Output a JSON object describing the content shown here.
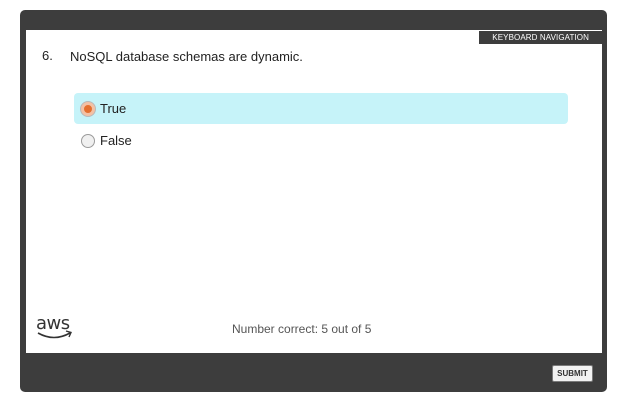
{
  "header": {
    "keyboard_navigation": "KEYBOARD NAVIGATION"
  },
  "question": {
    "number": "6.",
    "text": "NoSQL database schemas are dynamic."
  },
  "options": [
    {
      "label": "True",
      "selected": true
    },
    {
      "label": "False",
      "selected": false
    }
  ],
  "footer": {
    "logo_text": "aws",
    "score_text": "Number correct: 5 out of 5",
    "submit_label": "SUBMIT"
  },
  "colors": {
    "frame": "#3d3d3d",
    "selected_option_bg": "#c6f3f9",
    "radio_selected": "#e46f2f"
  }
}
